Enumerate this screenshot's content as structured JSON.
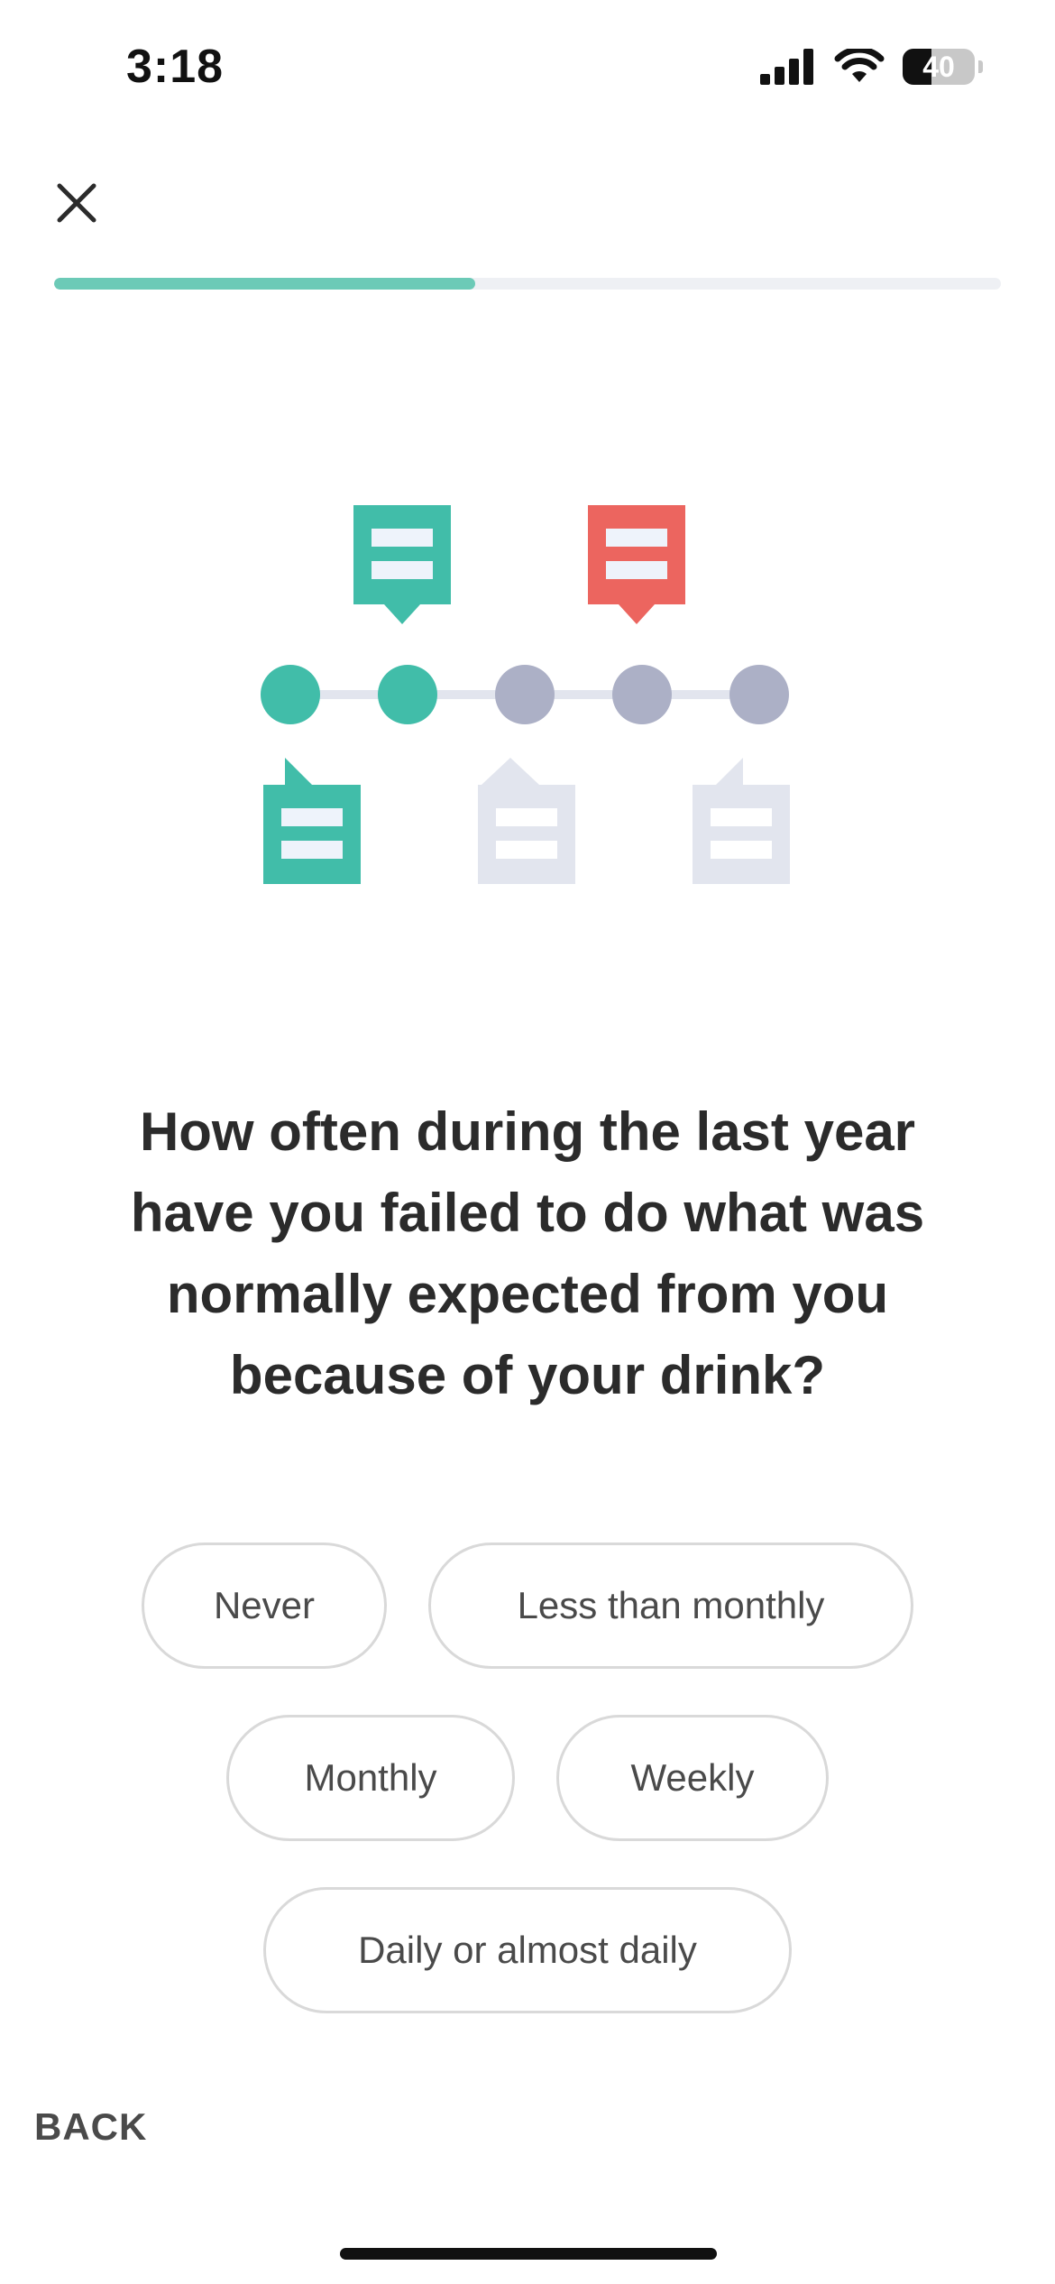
{
  "status_bar": {
    "time": "3:18",
    "battery_level": "40",
    "icons": [
      "cellular-signal-icon",
      "wifi-icon",
      "battery-icon"
    ]
  },
  "header": {
    "close_icon": "close-icon",
    "progress_fraction": 0.445
  },
  "illustration": {
    "name": "timeline-notes-illustration",
    "colors": {
      "teal": "#41bda9",
      "red": "#ec655f",
      "grey_dot": "#acb0c6",
      "grey_note": "#e2e5ee",
      "note_line": "#eef3fb"
    }
  },
  "question": {
    "text": "How often during the last year have you failed to do what was normally expected from you because of your drink?"
  },
  "answers": [
    [
      "Never",
      "Less than monthly"
    ],
    [
      "Monthly",
      "Weekly"
    ],
    [
      "Daily or almost daily"
    ]
  ],
  "footer": {
    "back_label": "BACK"
  },
  "colors": {
    "accent": "#6ccab7",
    "progress_track": "#eef0f4",
    "button_border": "#d9d9d9",
    "text": "#2b2b2b"
  }
}
